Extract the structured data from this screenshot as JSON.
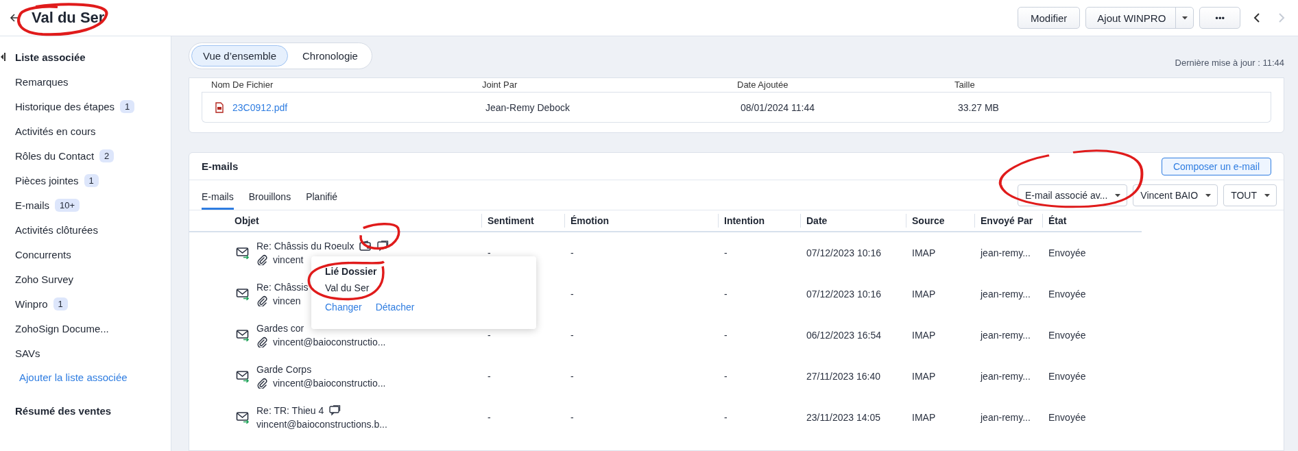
{
  "header": {
    "title": "Val du Ser",
    "edit_button": "Modifier",
    "split_button": "Ajout WINPRO",
    "more_button": "•••",
    "prev_enabled": true,
    "next_enabled": false
  },
  "sidebar": {
    "heading": "Liste associée",
    "items": [
      {
        "label": "Remarques"
      },
      {
        "label": "Historique des étapes",
        "badge": "1"
      },
      {
        "label": "Activités en cours"
      },
      {
        "label": "Rôles du Contact",
        "badge": "2"
      },
      {
        "label": "Pièces jointes",
        "badge": "1"
      },
      {
        "label": "E-mails",
        "badge": "10+"
      },
      {
        "label": "Activités clôturées"
      },
      {
        "label": "Concurrents"
      },
      {
        "label": "Zoho Survey"
      },
      {
        "label": "Winpro",
        "badge": "1"
      },
      {
        "label": "ZohoSign Docume..."
      },
      {
        "label": "SAVs"
      }
    ],
    "add_link": "Ajouter la liste associée",
    "section": "Résumé des ventes"
  },
  "view_tabs": [
    {
      "label": "Vue d’ensemble",
      "selected": true
    },
    {
      "label": "Chronologie",
      "selected": false
    }
  ],
  "last_update": "Dernière mise à jour : 11:44",
  "attachments": {
    "columns": [
      "Nom De Fichier",
      "Joint Par",
      "Date Ajoutée",
      "Taille"
    ],
    "rows": [
      {
        "file": "23C0912.pdf",
        "by": "Jean-Remy Debock",
        "date": "08/01/2024 11:44",
        "size": "33.27 MB"
      }
    ]
  },
  "emails": {
    "title": "E-mails",
    "compose": "Composer un e-mail",
    "tabs": [
      {
        "label": "E-mails",
        "selected": true
      },
      {
        "label": "Brouillons",
        "selected": false
      },
      {
        "label": "Planifié",
        "selected": false
      }
    ],
    "filters": [
      "E-mail associé av...",
      "Vincent BAIO",
      "TOUT"
    ],
    "columns": [
      "Objet",
      "Sentiment",
      "Émotion",
      "Intention",
      "Date",
      "Source",
      "Envoyé Par",
      "État"
    ],
    "rows": [
      {
        "subject": "Re: Châssis du Roeulx",
        "dossier": true,
        "chat": true,
        "attachment": true,
        "from": "vincent",
        "sentiment": "-",
        "emotion": "-",
        "intention": "-",
        "date": "07/12/2023 10:16",
        "source": "IMAP",
        "sender": "jean-remy...",
        "state": "Envoyée"
      },
      {
        "subject": "Re: Châssis",
        "dossier": false,
        "chat": false,
        "attachment": true,
        "from": "vincen",
        "emotion": "-",
        "intention": "-",
        "date": "07/12/2023 10:16",
        "source": "IMAP",
        "sender": "jean-remy...",
        "state": "Envoyée"
      },
      {
        "subject": "Gardes cor",
        "dossier": false,
        "chat": false,
        "attachment": true,
        "from": "vincent@baioconstructio...",
        "sentiment": "-",
        "emotion": "-",
        "intention": "-",
        "date": "06/12/2023 16:54",
        "source": "IMAP",
        "sender": "jean-remy...",
        "state": "Envoyée"
      },
      {
        "subject": "Garde Corps",
        "dossier": false,
        "chat": false,
        "attachment": true,
        "from": "vincent@baioconstructio...",
        "sentiment": "-",
        "emotion": "-",
        "intention": "-",
        "date": "27/11/2023 16:40",
        "source": "IMAP",
        "sender": "jean-remy...",
        "state": "Envoyée"
      },
      {
        "subject": "Re: TR: Thieu 4",
        "dossier": false,
        "chat": true,
        "attachment": false,
        "from": "vincent@baioconstructions.b...",
        "sentiment": "-",
        "emotion": "-",
        "intention": "-",
        "date": "23/11/2023 14:05",
        "source": "IMAP",
        "sender": "jean-remy...",
        "state": "Envoyée"
      }
    ]
  },
  "popover": {
    "title": "Lié Dossier",
    "value": "Val du Ser",
    "actions": [
      "Changer",
      "Détacher"
    ]
  }
}
